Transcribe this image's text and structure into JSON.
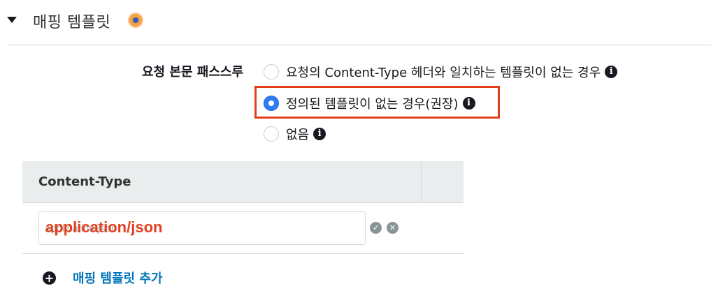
{
  "section": {
    "title": "매핑 템플릿"
  },
  "passthrough": {
    "label": "요청 본문 패스스루",
    "options": [
      {
        "label": "요청의 Content-Type 헤더와 일치하는 템플릿이 없는 경우",
        "selected": false
      },
      {
        "label": "정의된 템플릿이 없는 경우(권장)",
        "selected": true
      },
      {
        "label": "없음",
        "selected": false
      }
    ],
    "info_icon": "i"
  },
  "table": {
    "header": "Content-Type",
    "row": {
      "placeholder": "application/json",
      "annotation": "application/json",
      "confirm_icon": "✓",
      "remove_icon": "✕"
    }
  },
  "add": {
    "icon": "+",
    "label": "매핑 템플릿 추가"
  },
  "colors": {
    "highlight": "#e0401f",
    "link": "#0073bb",
    "radio_selected": "#2f7cf6"
  }
}
